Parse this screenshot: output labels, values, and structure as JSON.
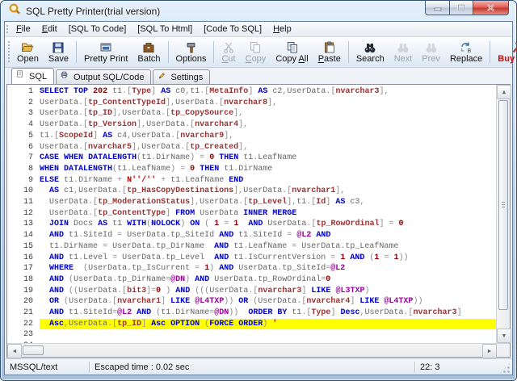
{
  "window": {
    "title": "SQL Pretty Printer(trial version)"
  },
  "window_controls": [
    {
      "name": "minimize",
      "icon": "minimize-icon"
    },
    {
      "name": "maximize",
      "icon": "maximize-icon"
    },
    {
      "name": "close",
      "icon": "close-icon"
    }
  ],
  "menu": {
    "items": [
      {
        "label": "File",
        "underline": 0
      },
      {
        "label": "Edit",
        "underline": 0
      },
      {
        "label": "[SQL To Code]",
        "underline": -1
      },
      {
        "label": "[SQL To Html]",
        "underline": -1
      },
      {
        "label": "[Code To SQL]",
        "underline": -1
      },
      {
        "label": "Help",
        "underline": 0
      }
    ]
  },
  "toolbar": {
    "buttons": [
      {
        "label": "Open",
        "icon": "open-folder-icon",
        "enabled": true,
        "underline": -1,
        "sep_after": false
      },
      {
        "label": "Save",
        "icon": "save-icon",
        "enabled": true,
        "underline": -1,
        "sep_after": true
      },
      {
        "label": "Pretty Print",
        "icon": "pretty-print-icon",
        "enabled": true,
        "underline": -1,
        "sep_after": false
      },
      {
        "label": "Batch",
        "icon": "batch-icon",
        "enabled": true,
        "underline": -1,
        "sep_after": true
      },
      {
        "label": "Options",
        "icon": "options-icon",
        "enabled": true,
        "underline": -1,
        "sep_after": true
      },
      {
        "label": "Cut",
        "icon": "cut-icon",
        "enabled": false,
        "underline": 0,
        "sep_after": false
      },
      {
        "label": "Copy",
        "icon": "copy-icon",
        "enabled": false,
        "underline": 0,
        "sep_after": false
      },
      {
        "label": "Copy All",
        "icon": "copy-all-icon",
        "enabled": true,
        "underline": 5,
        "sep_after": false
      },
      {
        "label": "Paste",
        "icon": "paste-icon",
        "enabled": true,
        "underline": 0,
        "sep_after": true
      },
      {
        "label": "Search",
        "icon": "search-icon",
        "enabled": true,
        "underline": -1,
        "sep_after": false
      },
      {
        "label": "Next",
        "icon": "next-icon",
        "enabled": false,
        "underline": -1,
        "sep_after": false
      },
      {
        "label": "Prev",
        "icon": "prev-icon",
        "enabled": false,
        "underline": -1,
        "sep_after": false
      },
      {
        "label": "Replace",
        "icon": "replace-icon",
        "enabled": true,
        "underline": -1,
        "sep_after": true
      },
      {
        "label": "Buy Now",
        "icon": "buy-now-icon",
        "enabled": true,
        "underline": -1,
        "sep_after": false,
        "accent": "#e00000"
      }
    ]
  },
  "tabs": [
    {
      "label": "SQL",
      "icon": "sql-doc-icon",
      "active": true
    },
    {
      "label": "Output SQL/Code",
      "icon": "output-icon",
      "active": false
    },
    {
      "label": "Settings",
      "icon": "settings-pencil-icon",
      "active": false
    }
  ],
  "editor": {
    "highlight_line": 22,
    "lines": [
      "SELECT TOP 202 t1.[Type] AS c0,t1.[MetaInfo] AS c2,UserData.[nvarchar3],",
      "UserData.[tp_ContentTypeId],UserData.[nvarchar8],",
      "UserData.[tp_ID],UserData.[tp_CopySource],",
      "UserData.[tp_Version],UserData.[nvarchar4],",
      "t1.[ScopeId] AS c4,UserData.[nvarchar9],",
      "UserData.[nvarchar5],UserData.[tp_Created],",
      "CASE WHEN DATALENGTH(t1.DirName) = 0 THEN t1.LeafName",
      "WHEN DATALENGTH(t1.LeafName) = 0 THEN t1.DirName",
      "ELSE t1.DirName + N''/'' + t1.LeafName END",
      "  AS c1,UserData.[tp_HasCopyDestinations],UserData.[nvarchar1],",
      "  UserData.[tp_ModerationStatus],UserData.[tp_Level],t1.[Id] AS c3,",
      "  UserData.[tp_ContentType] FROM UserData INNER MERGE",
      "  JOIN Docs AS t1 WITH(NOLOCK) ON ( 1 = 1  AND UserData.[tp_RowOrdinal] = 0",
      "  AND t1.SiteId = UserData.tp_SiteId AND t1.SiteId = @L2 AND",
      "  t1.DirName = UserData.tp_DirName  AND t1.LeafName = UserData.tp_LeafName",
      "  AND t1.Level = UserData.tp_Level  AND t1.IsCurrentVersion = 1 AND (1 = 1))",
      "  WHERE  (UserData.tp_IsCurrent = 1) AND UserData.tp_SiteId=@L2",
      "  AND (UserData.tp_DirName=@DN) AND UserData.tp_RowOrdinal=0",
      "  AND ((UserData.[bit3]=0 ) AND (((UserData.[nvarchar3] LIKE @L3TXP)",
      "  OR (UserData.[nvarchar1] LIKE @L4TXP)) OR (UserData.[nvarchar4] LIKE @L4TXP))",
      "  AND t1.SiteId=@L2 AND (t1.DirName=@DN))  ORDER BY t1.[Type] Desc,UserData.[nvarchar3]",
      "  Asc,UserData.[tp_ID] Asc OPTION (FORCE ORDER) '",
      "",
      ""
    ]
  },
  "statusbar": {
    "mode": "MSSQL/text",
    "time": "Escaped time : 0.02 sec",
    "position": "22: 3"
  },
  "colors": {
    "keyword": "#0000c8",
    "identifier": "#666666",
    "bracket_identifier": "#993333",
    "variable": "#990099",
    "number": "#8b0000",
    "string": "#c00000",
    "operator": "#8a8a8a",
    "highlight_line": "#ffff00",
    "buy_now_accent": "#e00000"
  }
}
